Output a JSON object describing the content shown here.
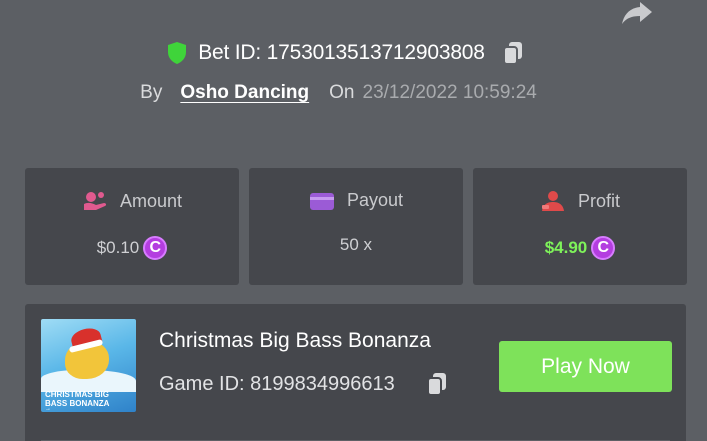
{
  "header": {
    "share_icon": "share-icon",
    "verified_icon": "shield-icon",
    "bet_id": "Bet ID: 1753013513712903808",
    "copy_icon": "copy-icon",
    "by_label": "By",
    "username": "Osho Dancing",
    "on_label": "On",
    "date": "23/12/2022 10:59:24"
  },
  "stats": {
    "amount": {
      "label": "Amount",
      "value": "$0.10",
      "icon": "money-hand-icon",
      "coin": "C"
    },
    "payout": {
      "label": "Payout",
      "value": "50 x",
      "icon": "card-icon"
    },
    "profit": {
      "label": "Profit",
      "value": "$4.90",
      "icon": "user-profit-icon",
      "coin": "C"
    }
  },
  "game": {
    "title": "Christmas Big Bass Bonanza",
    "game_id": "Game ID: 8199834996613",
    "play_label": "Play Now",
    "thumbnail_text": "CHRISTMAS BIG BASS BONANZA",
    "thumbnail_cta": "→"
  },
  "colors": {
    "background": "#5c5f64",
    "card": "#45474c",
    "accent_green": "#7ee25a",
    "coin_purple": "#b43de0",
    "icon_pink": "#e05a8f",
    "icon_purple": "#9b5bd6",
    "icon_red": "#e04a4a"
  }
}
